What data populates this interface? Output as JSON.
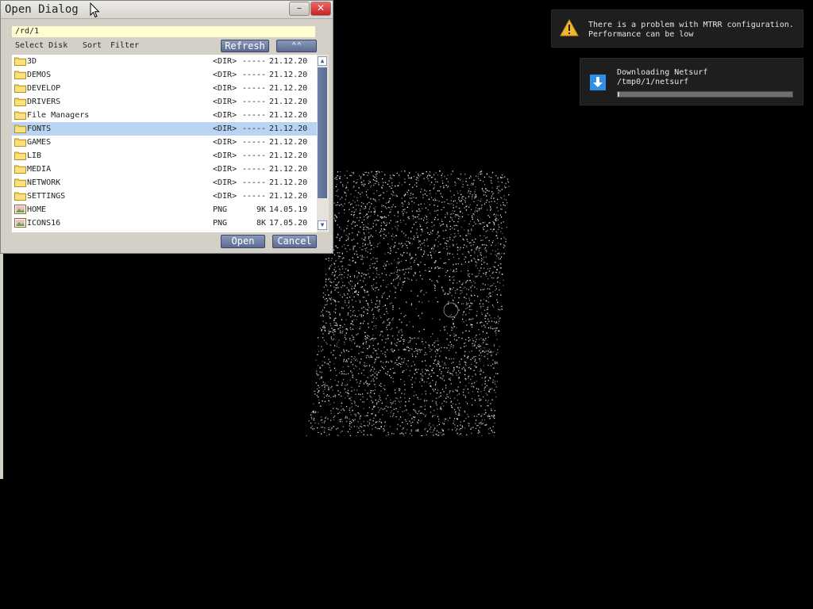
{
  "dialog": {
    "title": "Open Dialog",
    "minimize_label": "–",
    "close_label": "✕",
    "path_value": "/rd/1",
    "menu": {
      "select_disk": "Select Disk",
      "sort": "Sort",
      "filter": "Filter"
    },
    "refresh_label": "Refresh",
    "up_label": "⌃⌃",
    "open_label": "Open",
    "cancel_label": "Cancel",
    "files": [
      {
        "name": "3D",
        "type": "<DIR>",
        "size": "-----",
        "date": "21.12.20",
        "icon": "folder-icon",
        "selected": false
      },
      {
        "name": "DEMOS",
        "type": "<DIR>",
        "size": "-----",
        "date": "21.12.20",
        "icon": "folder-icon",
        "selected": false
      },
      {
        "name": "DEVELOP",
        "type": "<DIR>",
        "size": "-----",
        "date": "21.12.20",
        "icon": "folder-icon",
        "selected": false
      },
      {
        "name": "DRIVERS",
        "type": "<DIR>",
        "size": "-----",
        "date": "21.12.20",
        "icon": "folder-icon",
        "selected": false
      },
      {
        "name": "File Managers",
        "type": "<DIR>",
        "size": "-----",
        "date": "21.12.20",
        "icon": "folder-icon",
        "selected": false
      },
      {
        "name": "FONTS",
        "type": "<DIR>",
        "size": "-----",
        "date": "21.12.20",
        "icon": "folder-icon",
        "selected": true
      },
      {
        "name": "GAMES",
        "type": "<DIR>",
        "size": "-----",
        "date": "21.12.20",
        "icon": "folder-icon",
        "selected": false
      },
      {
        "name": "LIB",
        "type": "<DIR>",
        "size": "-----",
        "date": "21.12.20",
        "icon": "folder-icon",
        "selected": false
      },
      {
        "name": "MEDIA",
        "type": "<DIR>",
        "size": "-----",
        "date": "21.12.20",
        "icon": "folder-icon",
        "selected": false
      },
      {
        "name": "NETWORK",
        "type": "<DIR>",
        "size": "-----",
        "date": "21.12.20",
        "icon": "folder-icon",
        "selected": false
      },
      {
        "name": "SETTINGS",
        "type": "<DIR>",
        "size": "-----",
        "date": "21.12.20",
        "icon": "folder-icon",
        "selected": false
      },
      {
        "name": "HOME",
        "type": "PNG",
        "size": "9K",
        "date": "14.05.19",
        "icon": "image-file-icon",
        "selected": false
      },
      {
        "name": "ICONS16",
        "type": "PNG",
        "size": "8K",
        "date": "17.05.20",
        "icon": "image-file-icon",
        "selected": false
      }
    ]
  },
  "notifications": {
    "warning": {
      "icon": "warning-icon",
      "line1": "There is a problem with MTRR configuration.",
      "line2": "Performance can be low"
    },
    "download": {
      "icon": "download-icon",
      "line1": "Downloading Netsurf",
      "line2": "/tmp0/1/netsurf",
      "progress": 0.01
    }
  },
  "colors": {
    "desktop": "#000000",
    "window_face": "#d4d0c8",
    "path_field": "#fffccf",
    "selection": "#b8d4f2",
    "button": "#6f7fa6",
    "close_button": "#d93a3a",
    "notification_bg": "#1e1e1e"
  }
}
